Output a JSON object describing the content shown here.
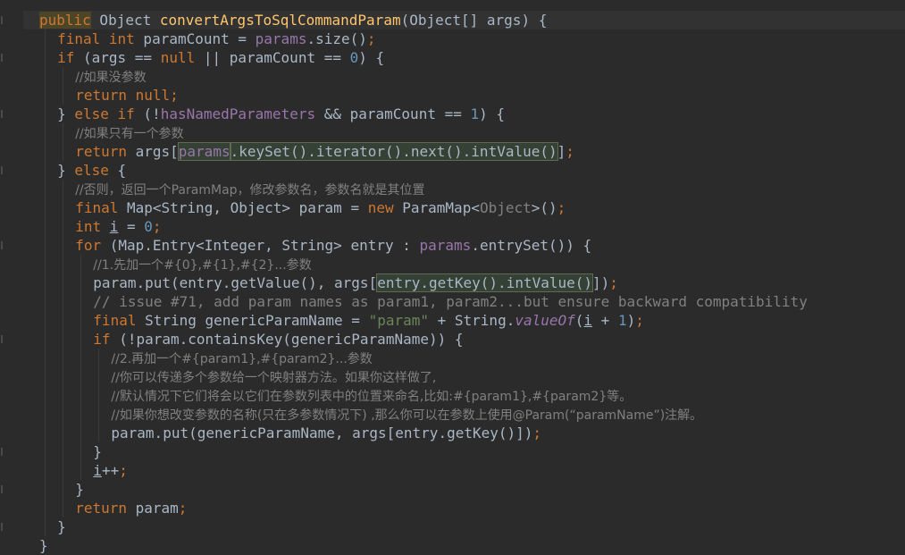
{
  "editor": {
    "language": "java",
    "colors": {
      "background": "#2b2b2b",
      "keyword": "#cc7832",
      "method": "#ffc66d",
      "field": "#9876aa",
      "number": "#6897bb",
      "comment": "#808080",
      "string": "#6a8759",
      "text": "#a9b7c6"
    },
    "lines": [
      [
        {
          "t": "public",
          "c": "kwhl"
        },
        {
          "t": " Object "
        },
        {
          "t": "convertArgsToSqlCommandParam",
          "c": "fn"
        },
        {
          "t": "(Object[] args) {"
        }
      ],
      [
        {
          "t": "final int",
          "c": "kw"
        },
        {
          "t": " paramCount = "
        },
        {
          "t": "params",
          "c": "fld"
        },
        {
          "t": ".size()"
        },
        {
          "t": ";",
          "c": "kw"
        }
      ],
      [
        {
          "t": "if",
          "c": "kw"
        },
        {
          "t": " (args == "
        },
        {
          "t": "null",
          "c": "kw"
        },
        {
          "t": " || paramCount == "
        },
        {
          "t": "0",
          "c": "num"
        },
        {
          "t": ") {"
        }
      ],
      [
        {
          "t": "//如果没参数",
          "c": "cm cmz"
        }
      ],
      [
        {
          "t": "return null;",
          "c": "kw"
        }
      ],
      [
        {
          "t": "} "
        },
        {
          "t": "else if",
          "c": "kw"
        },
        {
          "t": " (!"
        },
        {
          "t": "hasNamedParameters",
          "c": "fld"
        },
        {
          "t": " && paramCount == "
        },
        {
          "t": "1",
          "c": "num"
        },
        {
          "t": ") {"
        }
      ],
      [
        {
          "t": "//如果只有一个参数",
          "c": "cm cmz"
        }
      ],
      [
        {
          "t": "return",
          "c": "kw"
        },
        {
          "t": " args["
        },
        {
          "t": "params",
          "c": "fld hl"
        },
        {
          "t": ".keySet().iterator().next().intValue()",
          "c": "hl"
        },
        {
          "t": "]"
        },
        {
          "t": ";",
          "c": "kw"
        }
      ],
      [
        {
          "t": "} "
        },
        {
          "t": "else",
          "c": "kw"
        },
        {
          "t": " {"
        }
      ],
      [
        {
          "t": "//否则，返回一个ParamMap，修改参数名，参数名就是其位置",
          "c": "cm cmz"
        }
      ],
      [
        {
          "t": "final",
          "c": "kw"
        },
        {
          "t": " Map<String, Object> param = "
        },
        {
          "t": "new",
          "c": "kw"
        },
        {
          "t": " ParamMap<"
        },
        {
          "t": "Object",
          "c": "cm"
        },
        {
          "t": ">()"
        },
        {
          "t": ";",
          "c": "kw"
        }
      ],
      [
        {
          "t": "int",
          "c": "kw"
        },
        {
          "t": " "
        },
        {
          "t": "i",
          "c": "ul"
        },
        {
          "t": " = "
        },
        {
          "t": "0",
          "c": "num"
        },
        {
          "t": ";",
          "c": "kw"
        }
      ],
      [
        {
          "t": "for",
          "c": "kw"
        },
        {
          "t": " (Map.Entry<Integer, String> entry : "
        },
        {
          "t": "params",
          "c": "fld"
        },
        {
          "t": ".entrySet()) {"
        }
      ],
      [
        {
          "t": "//1.先加一个#{0},#{1},#{2}...参数",
          "c": "cm cmz"
        }
      ],
      [
        {
          "t": "param.put(entry.getValue(), args["
        },
        {
          "t": "entry.getKey().intValue()",
          "c": "hl"
        },
        {
          "t": "])"
        },
        {
          "t": ";",
          "c": "kw"
        }
      ],
      [
        {
          "t": "// issue #71, add param names as param1, param2...but ensure backward compatibility",
          "c": "cm"
        }
      ],
      [
        {
          "t": "final",
          "c": "kw"
        },
        {
          "t": " String genericParamName = "
        },
        {
          "t": "\"param\"",
          "c": "str"
        },
        {
          "t": " + String."
        },
        {
          "t": "valueOf",
          "c": "it"
        },
        {
          "t": "("
        },
        {
          "t": "i",
          "c": "ul"
        },
        {
          "t": " + "
        },
        {
          "t": "1",
          "c": "num"
        },
        {
          "t": ")"
        },
        {
          "t": ";",
          "c": "kw"
        }
      ],
      [
        {
          "t": "if",
          "c": "kw"
        },
        {
          "t": " (!param.containsKey(genericParamName)) {"
        }
      ],
      [
        {
          "t": "//2.再加一个#{param1},#{param2}...参数",
          "c": "cm cmz"
        }
      ],
      [
        {
          "t": "//你可以传递多个参数给一个映射器方法。如果你这样做了,",
          "c": "cm cmz"
        }
      ],
      [
        {
          "t": "//默认情况下它们将会以它们在参数列表中的位置来命名,比如:#{param1},#{param2}等。",
          "c": "cm cmz"
        }
      ],
      [
        {
          "t": "//如果你想改变参数的名称(只在多参数情况下) ,那么你可以在参数上使用@Param(“paramName”)注解。",
          "c": "cm cmz"
        }
      ],
      [
        {
          "t": "param.put(genericParamName, args[entry.getKey()])"
        },
        {
          "t": ";",
          "c": "kw"
        }
      ],
      [
        {
          "t": "}"
        }
      ],
      [
        {
          "t": "i",
          "c": "ul"
        },
        {
          "t": "++"
        },
        {
          "t": ";",
          "c": "kw"
        }
      ],
      [
        {
          "t": "}"
        }
      ],
      [
        {
          "t": "return",
          "c": "kw"
        },
        {
          "t": " param"
        },
        {
          "t": ";",
          "c": "kw"
        }
      ],
      [
        {
          "t": "}"
        }
      ],
      [
        {
          "t": "}"
        }
      ]
    ]
  }
}
